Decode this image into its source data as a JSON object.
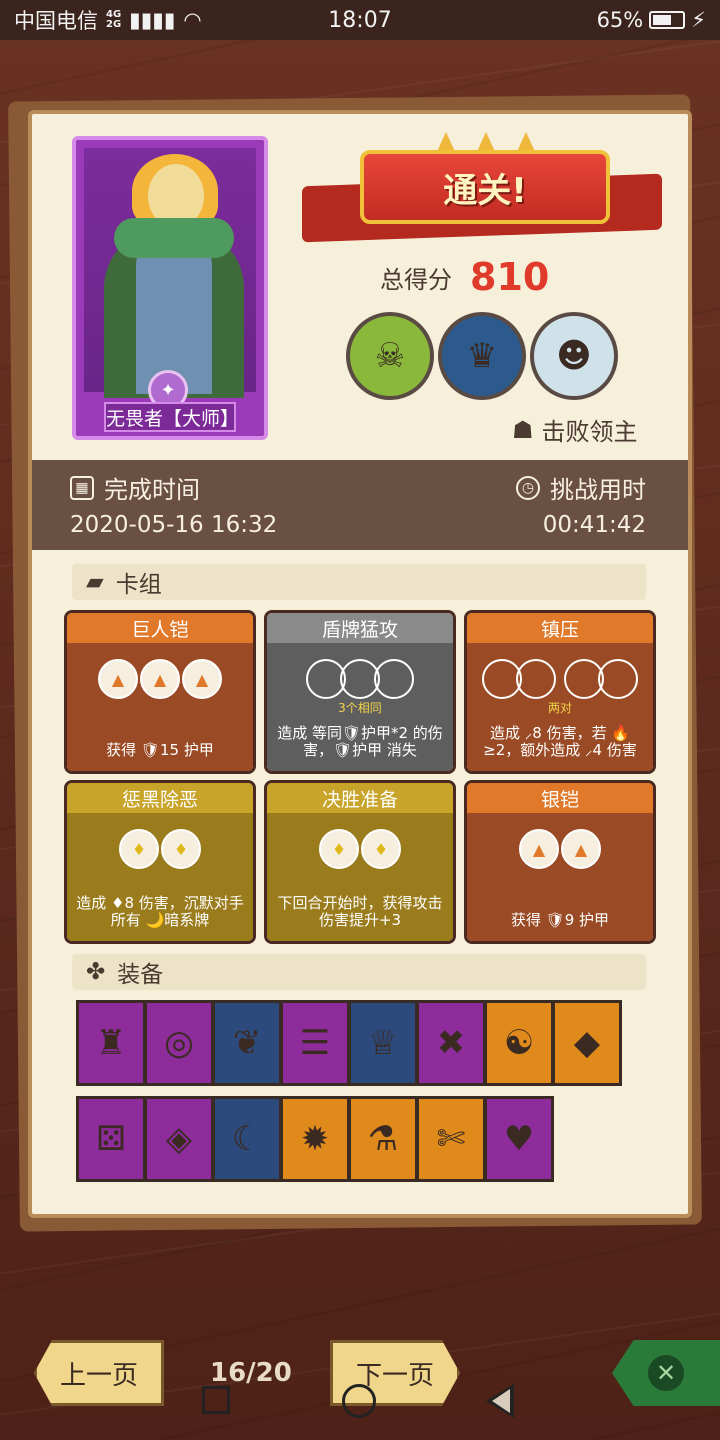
{
  "status_bar": {
    "carrier": "中国电信",
    "network_top": "4G",
    "network_bottom": "2G",
    "time": "18:07",
    "battery": "65%",
    "battery_level": 0.65
  },
  "hero": {
    "name": "无畏者【大师】"
  },
  "result": {
    "banner": "通关!",
    "score_label": "总得分",
    "score_value": "810",
    "defeat_label": "击败领主"
  },
  "time_info": {
    "finish_label": "完成时间",
    "finish_value": "2020-05-16 16:32",
    "challenge_label": "挑战用时",
    "challenge_value": "00:41:42"
  },
  "deck": {
    "title": "卡组",
    "cards": [
      {
        "name": "巨人铠",
        "desc": "获得 🛡15 护甲",
        "note": ""
      },
      {
        "name": "盾牌猛攻",
        "desc": "造成 等同🛡护甲*2 的伤害，🛡护甲 消失",
        "note": "3个相同"
      },
      {
        "name": "镇压",
        "desc": "造成 ⸝8 伤害，若 🔥 ≥2，额外造成 ⸝4 伤害",
        "note": "两对"
      },
      {
        "name": "惩黑除恶",
        "desc": "造成 ♦8 伤害，沉默对手所有 🌙暗系牌",
        "note": ""
      },
      {
        "name": "决胜准备",
        "desc": "下回合开始时，获得攻击伤害提升+3",
        "note": ""
      },
      {
        "name": "银铠",
        "desc": "获得 🛡9 护甲",
        "note": ""
      }
    ]
  },
  "equipment": {
    "title": "装备"
  },
  "nav": {
    "prev": "上一页",
    "page": "16/20",
    "next": "下一页"
  }
}
